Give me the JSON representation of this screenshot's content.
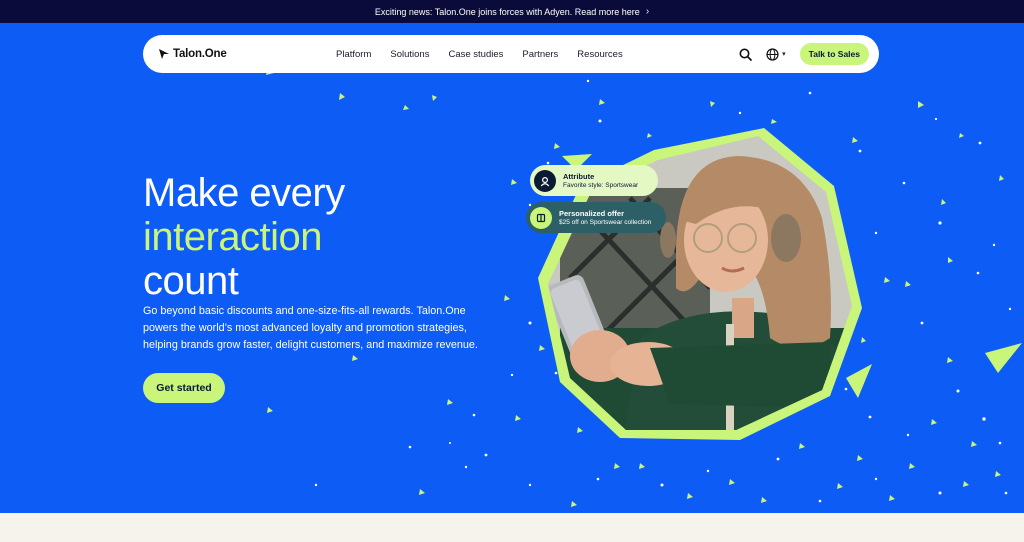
{
  "announcement": {
    "text": "Exciting news: Talon.One joins forces with Adyen. Read more here"
  },
  "nav": {
    "logo": "Talon.One",
    "items": [
      "Platform",
      "Solutions",
      "Case studies",
      "Partners",
      "Resources"
    ],
    "cta": "Talk to Sales",
    "icons": [
      "search-icon",
      "globe-icon"
    ]
  },
  "hero": {
    "title_line1": "Make every",
    "title_line2": "interaction",
    "title_line3": "count",
    "subtitle": "Go beyond basic discounts and one-size-fits-all rewards. Talon.One powers the world’s most advanced loyalty and promotion strategies, helping brands grow faster, delight customers, and maximize revenue.",
    "cta": "Get started"
  },
  "cards": [
    {
      "title": "Attribute",
      "desc": "Favorite style: Sportswear"
    },
    {
      "title": "Personalized offer",
      "desc": "$25 off on Sportswear collection"
    }
  ],
  "colors": {
    "hero_bg": "#0d5cf5",
    "accent": "#c8f57a",
    "topbar": "#0b0b3b"
  }
}
